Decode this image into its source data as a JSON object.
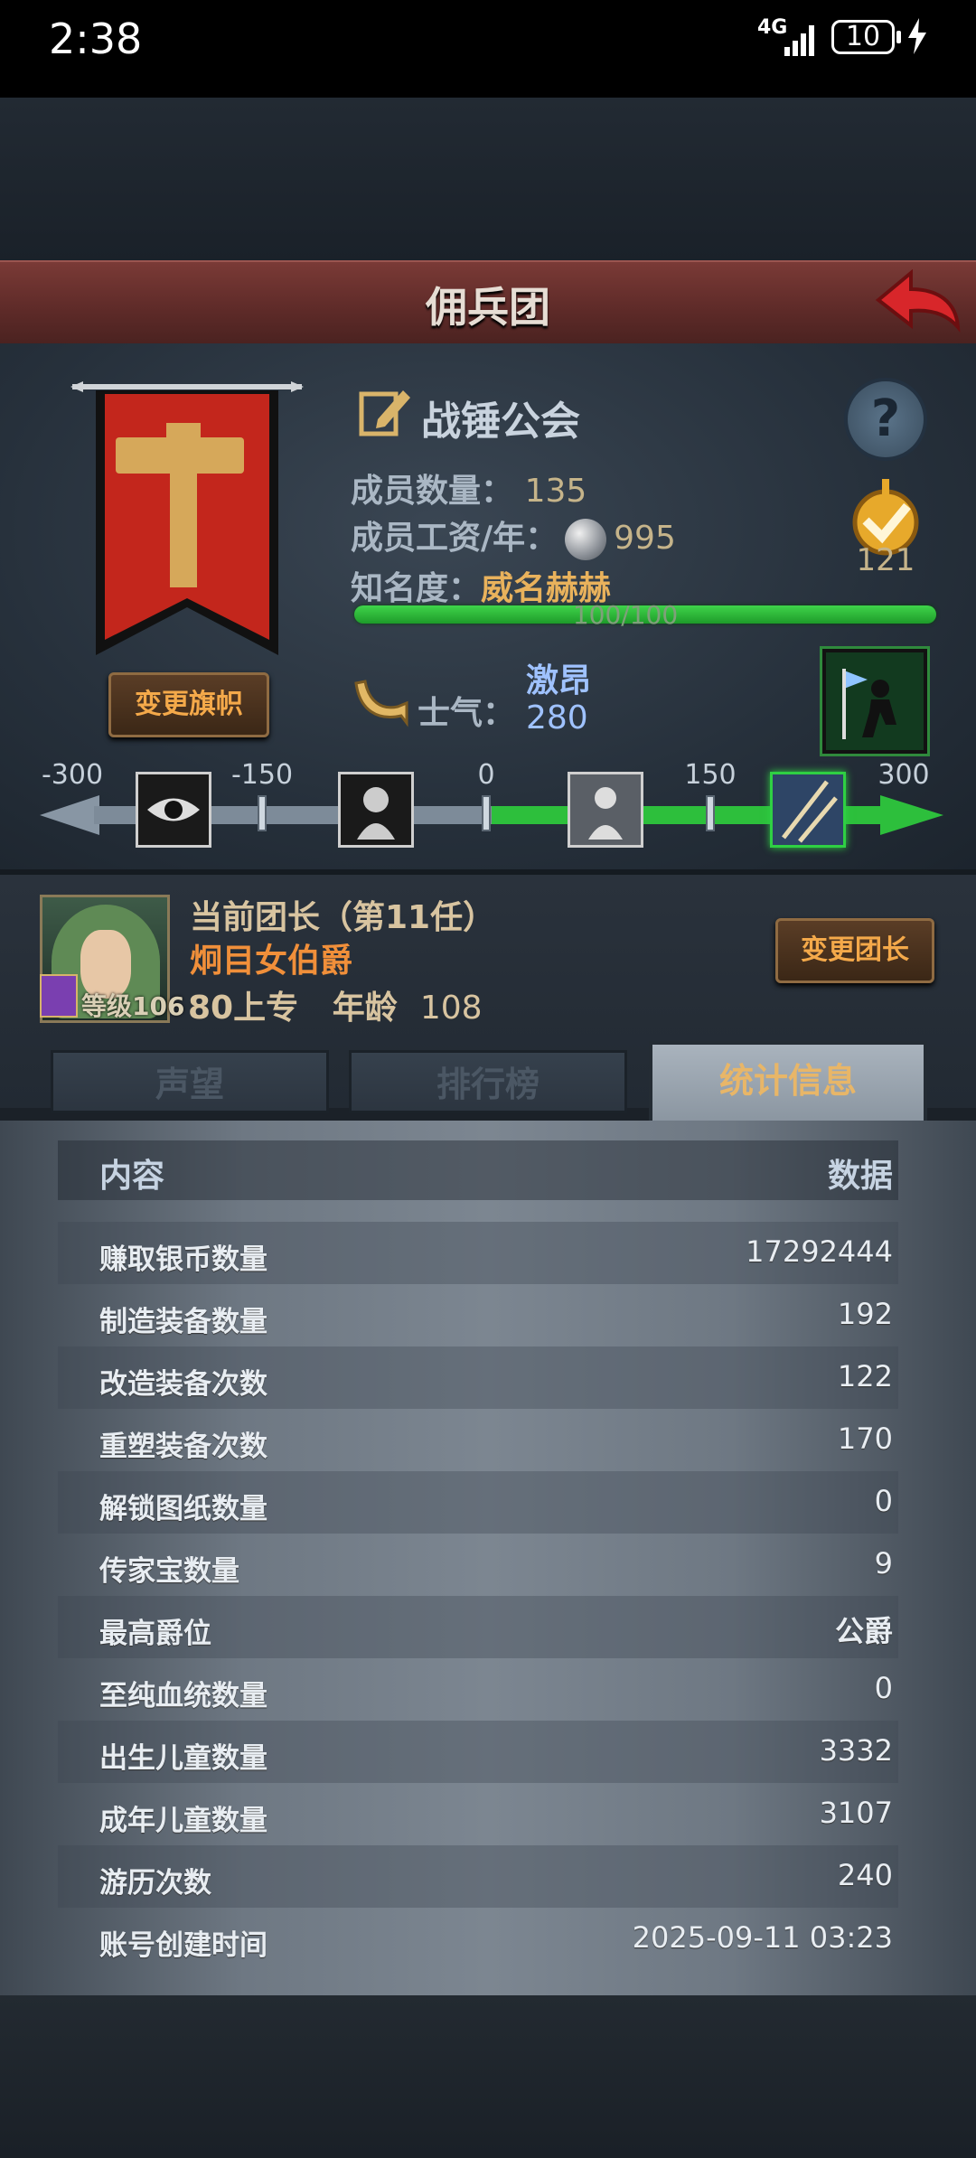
{
  "status_bar": {
    "time": "2:38",
    "network": "4G",
    "battery": "10"
  },
  "header": {
    "title": "佣兵团"
  },
  "guild": {
    "change_flag_label": "变更旗帜",
    "name": "战锤公会",
    "members_label": "成员数量：",
    "members_value": "135",
    "salary_label": "成员工资/年：",
    "salary_value": "995",
    "fame_label": "知名度：",
    "fame_value": "威名赫赫",
    "fame_progress_text": "100/100",
    "fame_progress": 1.0,
    "rank_value": "121",
    "morale_label": "士气：",
    "morale_word": "激昂",
    "morale_value": "280"
  },
  "morale_scale": {
    "ticks": [
      "-300",
      "-150",
      "0",
      "150",
      "300"
    ],
    "current": 280,
    "range": [
      -300,
      300
    ]
  },
  "leader": {
    "title": "当前团长（第11任）",
    "name": "炯目女伯爵",
    "level_text": "等级106",
    "info_prefix": "80上专",
    "age_label": "年龄",
    "age_value": "108",
    "change_leader_label": "变更团长"
  },
  "tabs": [
    "声望",
    "排行榜",
    "统计信息"
  ],
  "active_tab": 2,
  "stats_table": {
    "header": {
      "content": "内容",
      "data": "数据"
    },
    "rows": [
      {
        "k": "赚取银币数量",
        "v": "17292444"
      },
      {
        "k": "制造装备数量",
        "v": "192"
      },
      {
        "k": "改造装备次数",
        "v": "122"
      },
      {
        "k": "重塑装备次数",
        "v": "170"
      },
      {
        "k": "解锁图纸数量",
        "v": "0"
      },
      {
        "k": "传家宝数量",
        "v": "9"
      },
      {
        "k": "最高爵位",
        "v": "公爵"
      },
      {
        "k": "至纯血统数量",
        "v": "0"
      },
      {
        "k": "出生儿童数量",
        "v": "3332"
      },
      {
        "k": "成年儿童数量",
        "v": "3107"
      },
      {
        "k": "游历次数",
        "v": "240"
      },
      {
        "k": "账号创建时间",
        "v": "2025-09-11 03:23"
      }
    ]
  },
  "colors": {
    "accent": "#e8b668",
    "header": "#6a302d",
    "progress": "#2dbf3c"
  }
}
